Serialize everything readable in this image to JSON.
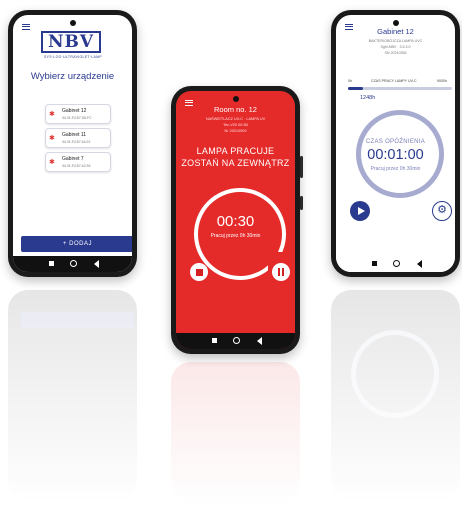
{
  "left_screen": {
    "logo_text": "NBV",
    "logo_tagline": "SYS·LOG·ULTRAVIOLET·LAMP",
    "title": "Wybierz urządzenie",
    "devices": [
      {
        "name": "Gabinet 12",
        "mac": "34:31:F4:57:3D:FC"
      },
      {
        "name": "Gabinet 11",
        "mac": "34:31:F4:57:44:22"
      },
      {
        "name": "Gabinet 7",
        "mac": "34:31:F4:57:42:39"
      }
    ],
    "add_button_label": "+ DODAJ",
    "brand_color": "#2a3a8f"
  },
  "middle_screen": {
    "room_title": "Room no. 12",
    "info_lines": [
      "NAŚWIETLACZ UV-C · LAMPA UV",
      "Tec-V20 00:3B",
      "Nr 20210909"
    ],
    "status_line_1": "LAMPA PRACUJE",
    "status_line_2": "ZOSTAŃ NA ZEWNĄTRZ",
    "timer": "00:30",
    "timer_caption": "Pracuj przez 0h 30min",
    "background_color": "#e52a2a",
    "stop_icon": "stop-icon",
    "pause_icon": "pause-icon"
  },
  "right_screen": {
    "title": "Gabinet 12",
    "info_lines": [
      "BAKTERIOBÓJCZA LAMPA UVC",
      "Sghi-NBV · 3.5.3.0",
      "SN 20210355"
    ],
    "progress": {
      "left_label": "0h",
      "center_label": "CZAS PRACY LAMPY UV-C",
      "right_label": "9000h",
      "fraction": 0.14
    },
    "hours_value": "1248h",
    "delay_label": "CZAS OPÓŹNIENIA",
    "delay_value": "00:01:00",
    "work_caption": "Pracuj przez 0h 30min",
    "play_icon": "play-icon",
    "settings_icon": "gear-icon"
  }
}
